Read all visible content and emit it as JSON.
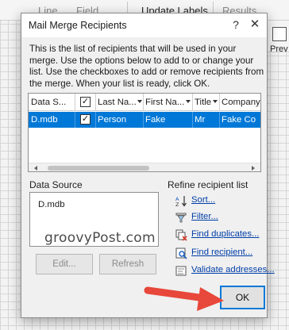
{
  "background": {
    "ribbon_items": [
      "Line",
      "Field",
      "Update Labels",
      "Results"
    ],
    "preview_label": "Prev"
  },
  "dialog": {
    "title": "Mail Merge Recipients",
    "help_glyph": "?",
    "close_glyph": "✕",
    "intro": "This is the list of recipients that will be used in your merge.  Use the options below to add to or change your list.  Use the checkboxes to add or remove recipients from the merge.  When your list is ready, click OK.",
    "grid": {
      "headers": [
        "Data S...",
        "",
        "Last Na...",
        "First Na...",
        "Title",
        "Company ..."
      ],
      "rows": [
        {
          "data_source": "D.mdb",
          "checked": "✓",
          "last_name": "Person",
          "first_name": "Fake",
          "title": "Mr",
          "company": "Fake Co"
        }
      ],
      "header_check": "✓"
    },
    "data_source": {
      "label": "Data Source",
      "items": [
        "D.mdb"
      ],
      "edit_label": "Edit...",
      "refresh_label": "Refresh"
    },
    "refine": {
      "label": "Refine recipient list",
      "items": [
        {
          "label": "Sort...",
          "icon": "sort-icon"
        },
        {
          "label": "Filter...",
          "icon": "filter-icon"
        },
        {
          "label": "Find duplicates...",
          "icon": "find-duplicates-icon"
        },
        {
          "label": "Find recipient...",
          "icon": "find-recipient-icon"
        },
        {
          "label": "Validate addresses...",
          "icon": "validate-addresses-icon"
        }
      ]
    },
    "ok_label": "OK"
  },
  "watermark": "groovyPost.com",
  "colors": {
    "selection": "#0078d7",
    "link": "#003ea8",
    "annotation_arrow": "#e8473b"
  }
}
